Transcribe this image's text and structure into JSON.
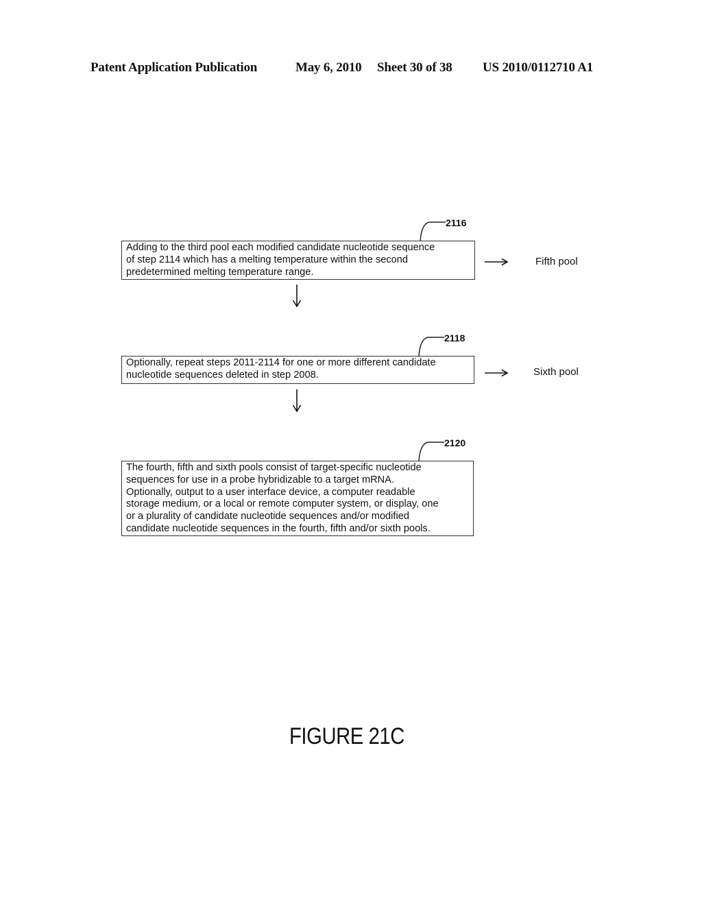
{
  "header": {
    "publication": "Patent Application Publication",
    "date": "May 6, 2010",
    "sheet": "Sheet 30 of 38",
    "number": "US 2010/0112710 A1"
  },
  "steps": [
    {
      "ref": "2116",
      "lines": [
        "Adding to the third pool each modified candidate nucleotide sequence",
        "of step 2114 which has a melting temperature within the second",
        "predetermined melting temperature range."
      ],
      "output": "Fifth pool"
    },
    {
      "ref": "2118",
      "lines": [
        "Optionally, repeat steps 2011-2114 for one or more different candidate",
        "nucleotide sequences deleted in step 2008."
      ],
      "output": "Sixth pool"
    },
    {
      "ref": "2120",
      "lines": [
        "The fourth, fifth and sixth pools consist of target-specific nucleotide",
        "sequences for use in a probe hybridizable to a target mRNA.",
        "Optionally, output to a user interface device, a computer readable",
        "storage medium, or a local or remote computer system, or display, one",
        "or a plurality of candidate nucleotide sequences and/or modified",
        "candidate nucleotide sequences in the fourth, fifth and/or sixth pools."
      ]
    }
  ],
  "figure_label": "FIGURE 21C",
  "icons": {
    "down_arrow": "down-arrow-icon",
    "right_arrow": "right-arrow-icon"
  }
}
